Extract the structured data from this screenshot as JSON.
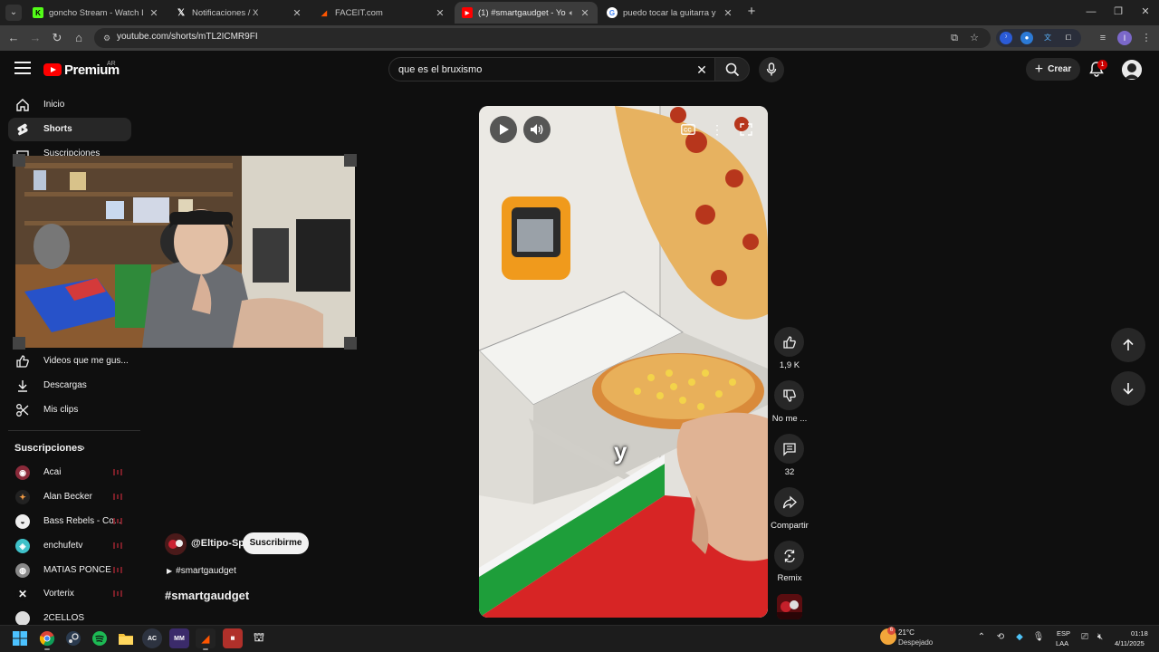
{
  "browser": {
    "tabs": [
      {
        "title": "goncho Stream - Watch Live on",
        "favicon": "kick-icon"
      },
      {
        "title": "Notificaciones / X",
        "favicon": "x-icon"
      },
      {
        "title": "FACEIT.com",
        "favicon": "faceit-icon"
      },
      {
        "title": "(1) #smartgaudget - YouTube",
        "favicon": "youtube-icon"
      },
      {
        "title": "puedo tocar la guitarra y aprender",
        "favicon": "google-icon"
      }
    ],
    "active_tab": 3,
    "url": "youtube.com/shorts/mTL2ICMR9FI"
  },
  "youtube": {
    "logo_text": "Premium",
    "country": "AR",
    "search": {
      "query": "que es el bruxismo"
    },
    "create_label": "Crear",
    "notif_count": "1"
  },
  "sidebar": {
    "items": [
      {
        "label": "Inicio",
        "icon": "home-icon"
      },
      {
        "label": "Shorts",
        "icon": "shorts-icon"
      },
      {
        "label": "Suscripciones",
        "icon": "subscriptions-icon"
      }
    ],
    "lower_items": [
      {
        "label": "Videos que me gus...",
        "icon": "thumbs-up-icon"
      },
      {
        "label": "Descargas",
        "icon": "download-icon"
      },
      {
        "label": "Mis clips",
        "icon": "scissors-icon"
      }
    ],
    "subs_header": "Suscripciones",
    "subscriptions": [
      {
        "name": "Acai"
      },
      {
        "name": "Alan Becker"
      },
      {
        "name": "Bass Rebels - Co..."
      },
      {
        "name": "enchufetv"
      },
      {
        "name": "MATIAS PONCE"
      },
      {
        "name": "Vorterix"
      },
      {
        "name": "2CELLOS"
      }
    ]
  },
  "short": {
    "channel": "@Eltipo-Sp",
    "subscribe_label": "Suscribirme",
    "hashtag": "#smartgaudget",
    "title": "#smartgaudget",
    "caption": "y",
    "actions": {
      "likes": "1,9 K",
      "dislike": "No me ...",
      "comments": "32",
      "share": "Compartir",
      "remix": "Remix"
    }
  },
  "taskbar": {
    "temp": "21°C",
    "weather": "Despejado",
    "weather_badge": "6",
    "lang_top": "ESP",
    "lang_bottom": "LAA",
    "time": "01:18",
    "date": "4/11/2025"
  },
  "colors": {
    "yt_red": "#ff0000",
    "bg": "#0f0f0f",
    "chip": "#272727"
  }
}
